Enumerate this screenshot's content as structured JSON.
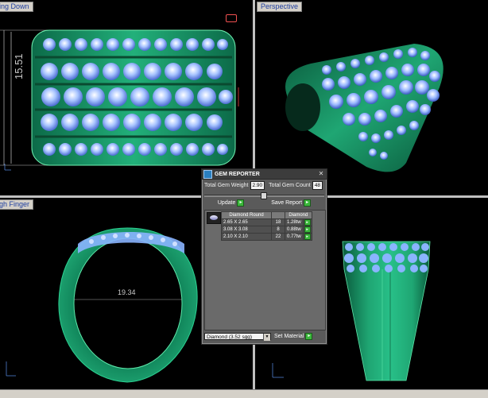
{
  "viewports": {
    "top_left": {
      "title": "ing Down",
      "dimension": "15.51"
    },
    "top_right": {
      "title": "Perspective"
    },
    "bottom_left": {
      "title": "gh Finger",
      "dimension": "19.34"
    },
    "bottom_right": {
      "title": ""
    }
  },
  "gem_reporter": {
    "title": "GEM REPORTER",
    "total_weight_label": "Total Gem Weight",
    "total_weight_value": "2.90",
    "total_count_label": "Total Gem Count",
    "total_count_value": "48",
    "update_label": "Update",
    "save_report_label": "Save Report",
    "table": {
      "headers": [
        "Diamond Round",
        "",
        "Diamond"
      ],
      "rows": [
        {
          "size": "2.65 X 2.65",
          "count": "18",
          "weight": "1.28tw"
        },
        {
          "size": "3.08 X 3.08",
          "count": "8",
          "weight": "0.88tw"
        },
        {
          "size": "2.10 X 2.10",
          "count": "22",
          "weight": "0.77tw"
        }
      ]
    },
    "material_select": "Diamond      (3.52 sgg)",
    "set_material_label": "Set Material"
  },
  "colors": {
    "ring_green": "#1fa673",
    "gem_blue": "#8ab4ff",
    "viewport_bg": "#000000"
  },
  "icons": [
    "close-icon",
    "green-arrow-icon",
    "gem-thumbnail",
    "dropdown-arrow-icon",
    "axis-icon"
  ]
}
